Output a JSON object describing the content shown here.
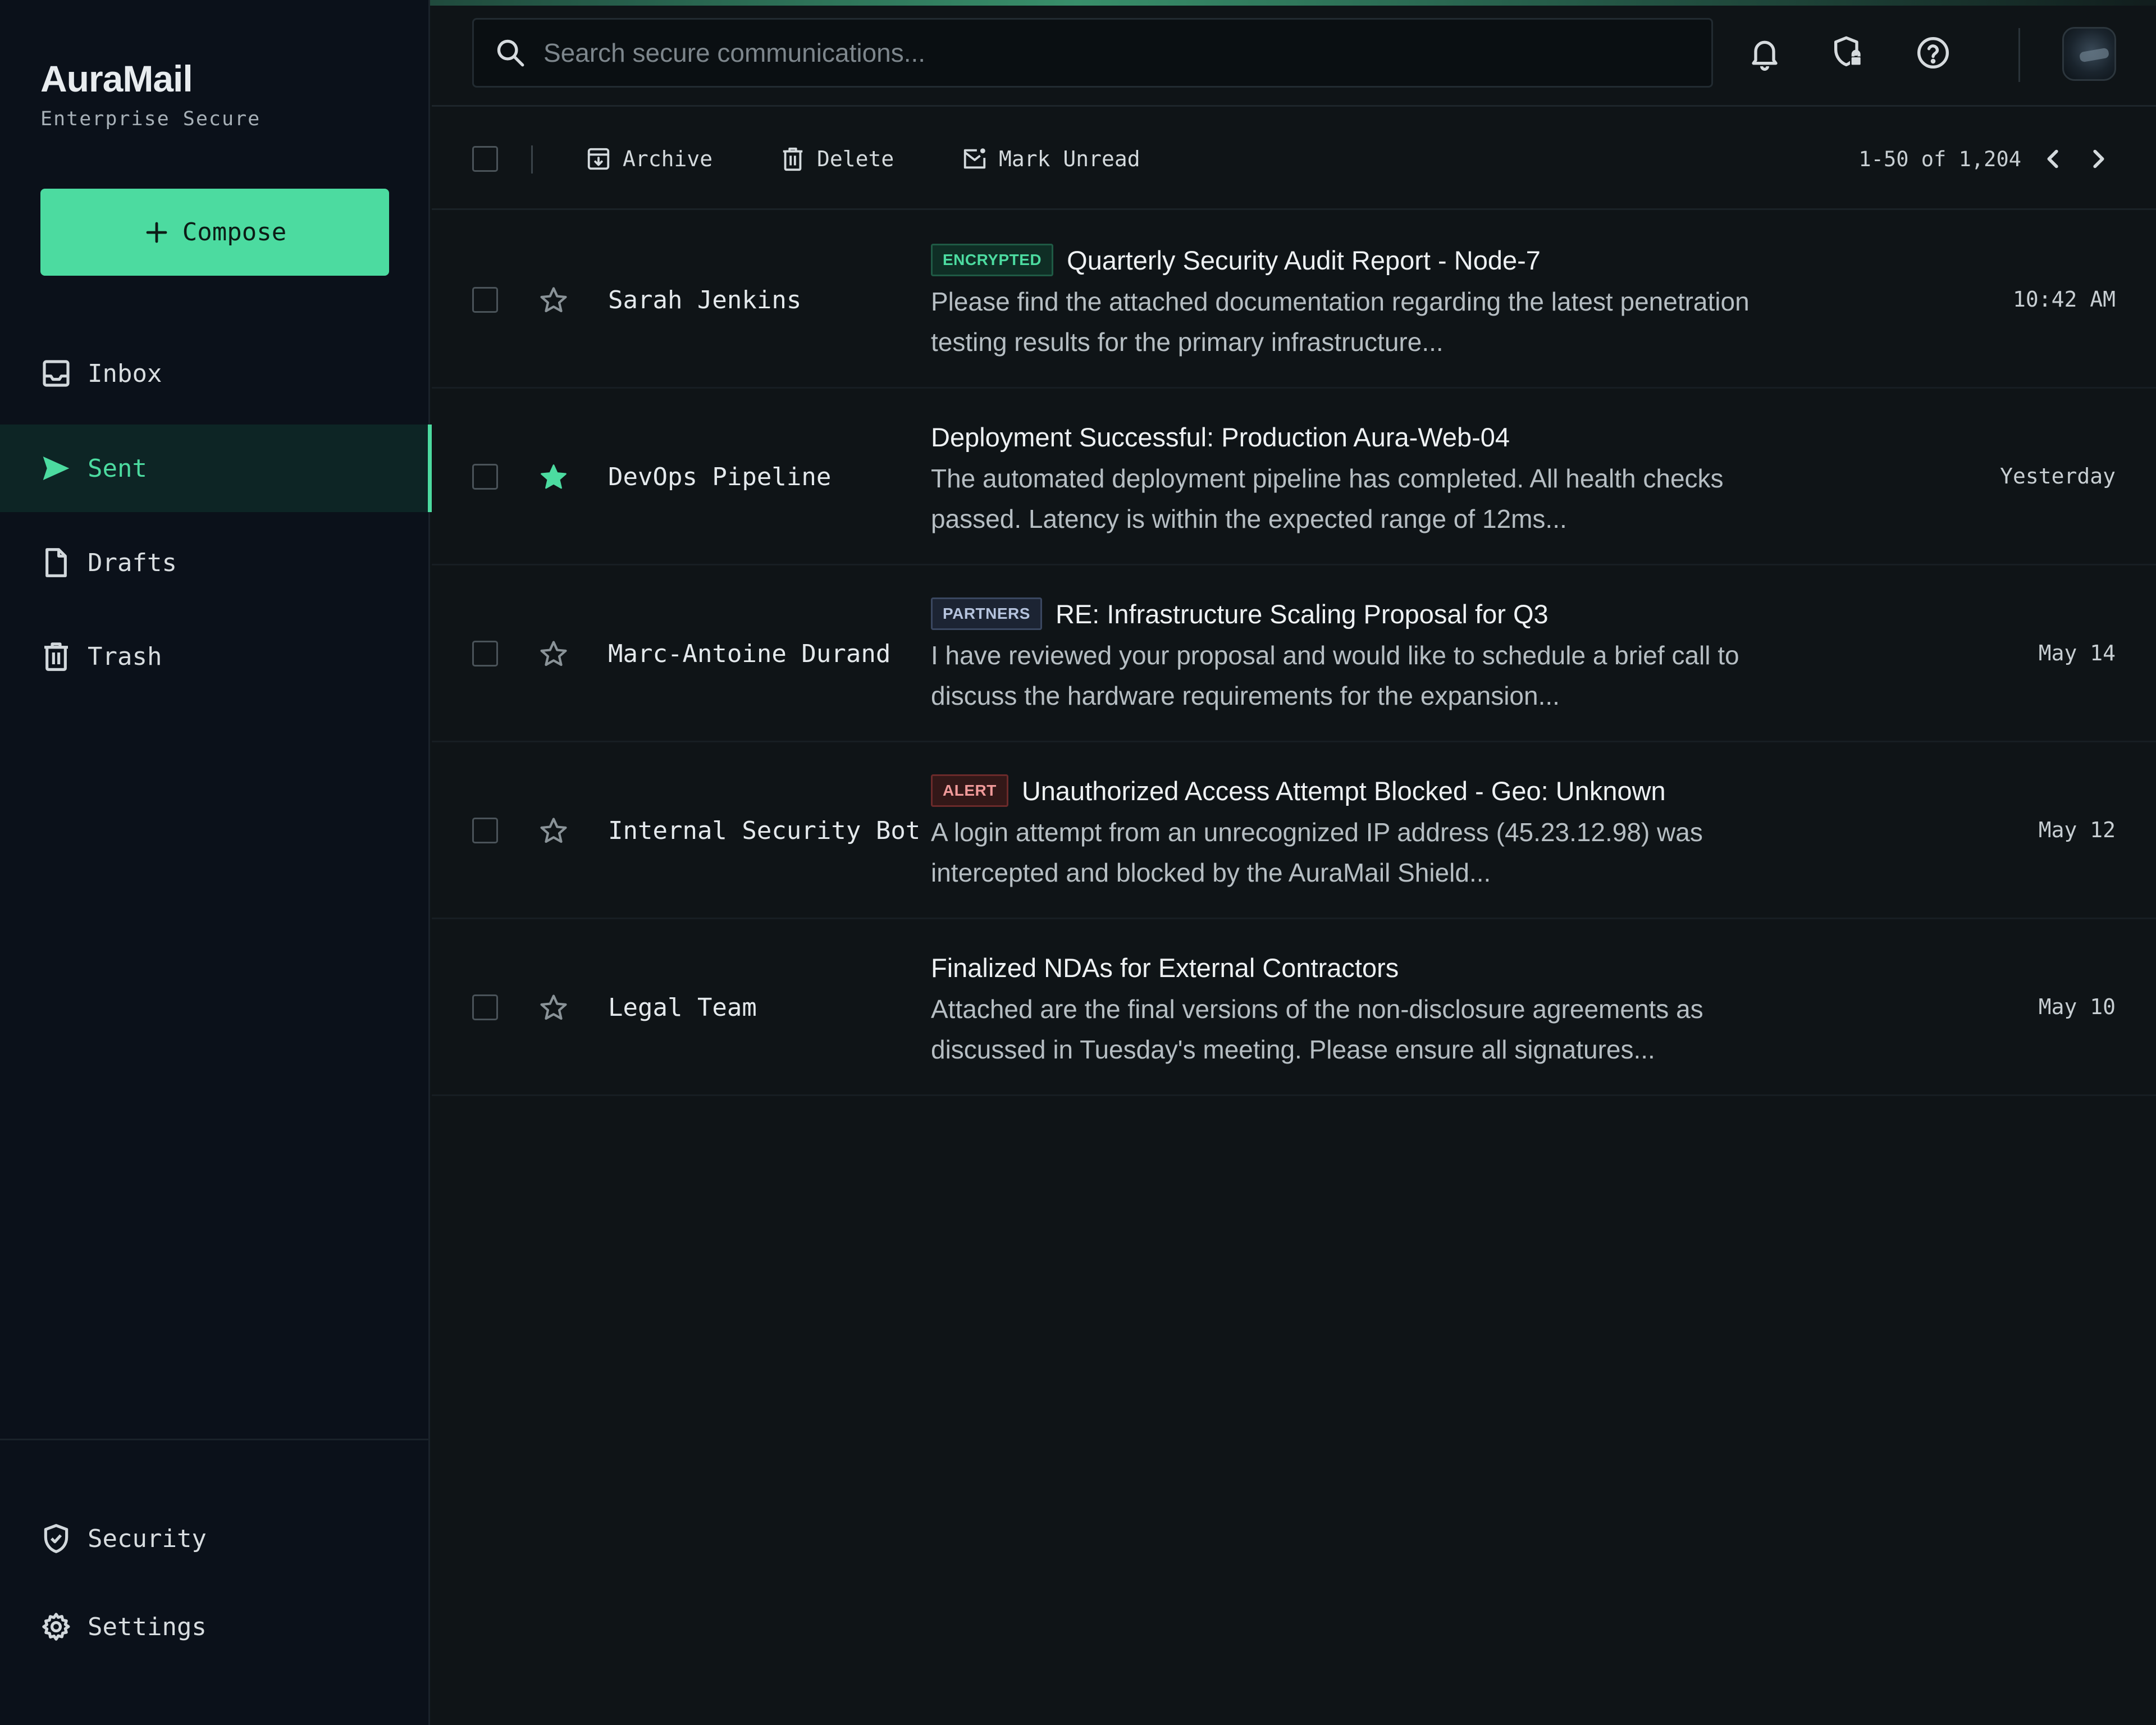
{
  "app": {
    "name": "AuraMail",
    "subtitle": "Enterprise Secure"
  },
  "colors": {
    "accent": "#4cdba0",
    "background": "#0f1417",
    "sidebar": "#0b111a"
  },
  "compose": {
    "label": "Compose",
    "icon": "plus-icon"
  },
  "nav": {
    "items": [
      {
        "label": "Inbox",
        "icon": "inbox-icon",
        "active": false
      },
      {
        "label": "Sent",
        "icon": "send-icon",
        "active": true
      },
      {
        "label": "Drafts",
        "icon": "file-icon",
        "active": false
      },
      {
        "label": "Trash",
        "icon": "trash-icon",
        "active": false
      }
    ],
    "bottom": [
      {
        "label": "Security",
        "icon": "shield-check-icon"
      },
      {
        "label": "Settings",
        "icon": "gear-icon"
      }
    ]
  },
  "search": {
    "placeholder": "Search secure communications...",
    "value": ""
  },
  "topbar": {
    "icons": [
      "bell-icon",
      "shield-lock-icon",
      "help-icon"
    ],
    "avatar": "avatar"
  },
  "toolbar": {
    "archive_label": "Archive",
    "delete_label": "Delete",
    "mark_unread_label": "Mark Unread",
    "pagination": "1-50 of 1,204"
  },
  "emails": [
    {
      "sender": "Sarah Jenkins",
      "badge": "ENCRYPTED",
      "badge_type": "encrypted",
      "subject": "Quarterly Security Audit Report - Node-7",
      "preview": "Please find the attached documentation regarding the latest penetration testing results for the primary infrastructure...",
      "date": "10:42 AM",
      "starred": false
    },
    {
      "sender": "DevOps Pipeline",
      "badge": "",
      "badge_type": "",
      "subject": "Deployment Successful: Production Aura-Web-04",
      "preview": "The automated deployment pipeline has completed. All health checks passed. Latency is within the expected range of 12ms...",
      "date": "Yesterday",
      "starred": true
    },
    {
      "sender": "Marc-Antoine Durand",
      "badge": "PARTNERS",
      "badge_type": "partners",
      "subject": "RE: Infrastructure Scaling Proposal for Q3",
      "preview": "I have reviewed your proposal and would like to schedule a brief call to discuss the hardware requirements for the expansion...",
      "date": "May 14",
      "starred": false
    },
    {
      "sender": "Internal Security Bot",
      "badge": "ALERT",
      "badge_type": "alert",
      "subject": "Unauthorized Access Attempt Blocked - Geo: Unknown",
      "preview": "A login attempt from an unrecognized IP address (45.23.12.98) was intercepted and blocked by the AuraMail Shield...",
      "date": "May 12",
      "starred": false
    },
    {
      "sender": "Legal Team",
      "badge": "",
      "badge_type": "",
      "subject": "Finalized NDAs for External Contractors",
      "preview": "Attached are the final versions of the non-disclosure agreements as discussed in Tuesday's meeting. Please ensure all signatures...",
      "date": "May 10",
      "starred": false
    }
  ]
}
